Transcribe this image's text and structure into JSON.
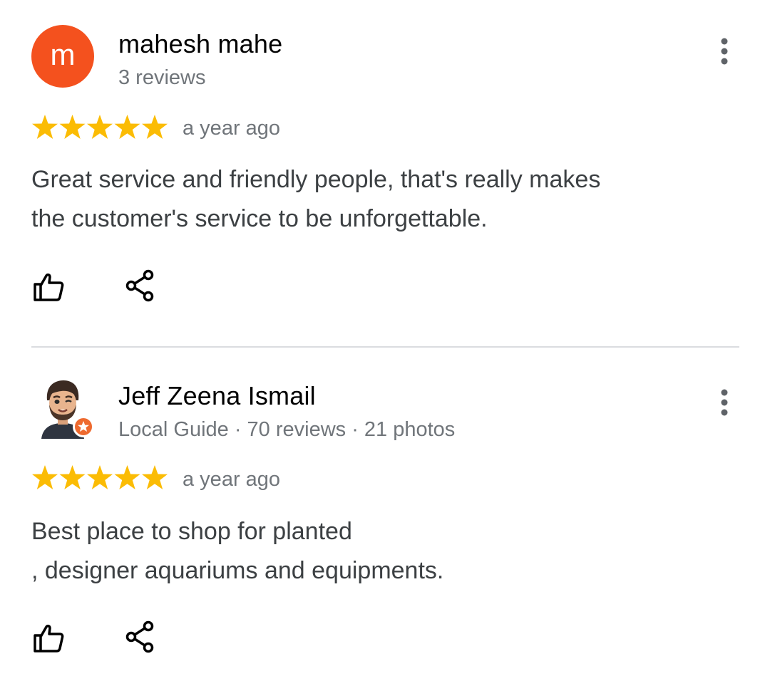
{
  "reviews": [
    {
      "author": "mahesh mahe",
      "avatar_letter": "m",
      "avatar_color": "#f4511e",
      "meta": "3 reviews",
      "rating": 5,
      "date": "a year ago",
      "text": "Great service and friendly people, that's really makes\nthe customer's service to be unforgettable.",
      "icons": [
        "more-vert-icon",
        "thumbs-up-icon",
        "share-icon"
      ]
    },
    {
      "author": "Jeff Zeena Ismail",
      "avatar_type": "cartoon",
      "meta": "Local Guide · 70 reviews · 21 photos",
      "rating": 5,
      "date": "a year ago",
      "text": "Best place to shop for planted\n, designer aquariums and equipments.",
      "icons": [
        "more-vert-icon",
        "thumbs-up-icon",
        "share-icon",
        "local-guide-badge-icon"
      ]
    }
  ],
  "colors": {
    "star": "#fbbc04",
    "name": "#000000",
    "meta": "#70757a",
    "body": "#3c4043",
    "divider": "#dadce0",
    "local_guide_badge": "#ee6a2f"
  }
}
